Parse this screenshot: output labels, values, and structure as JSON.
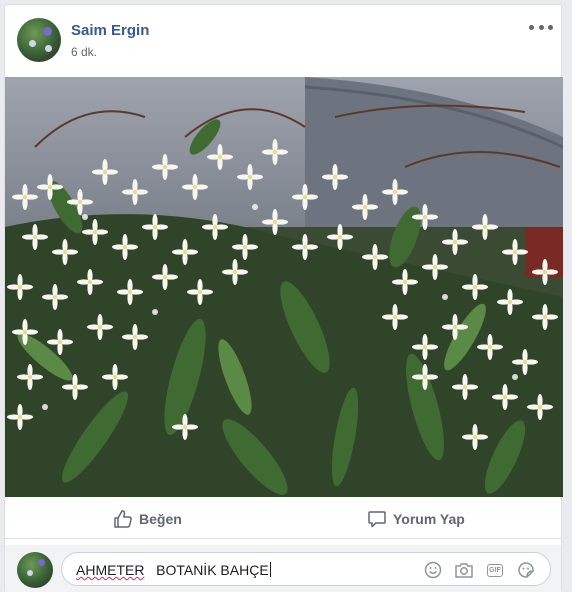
{
  "post": {
    "author": "Saim Ergin",
    "time": "6 dk.",
    "image_icon": "flowering-shrub-photo"
  },
  "actions": {
    "like_label": "Beğen",
    "comment_label": "Yorum Yap"
  },
  "composer": {
    "typed_name": "AHMETER",
    "typed_rest": "   BOTANİK BAHÇE",
    "icons": [
      "emoji-icon",
      "camera-icon",
      "gif-icon",
      "sticker-icon"
    ]
  },
  "colors": {
    "author_link": "#385898",
    "action_text": "#606770",
    "spell_underline": "#e0245e"
  }
}
